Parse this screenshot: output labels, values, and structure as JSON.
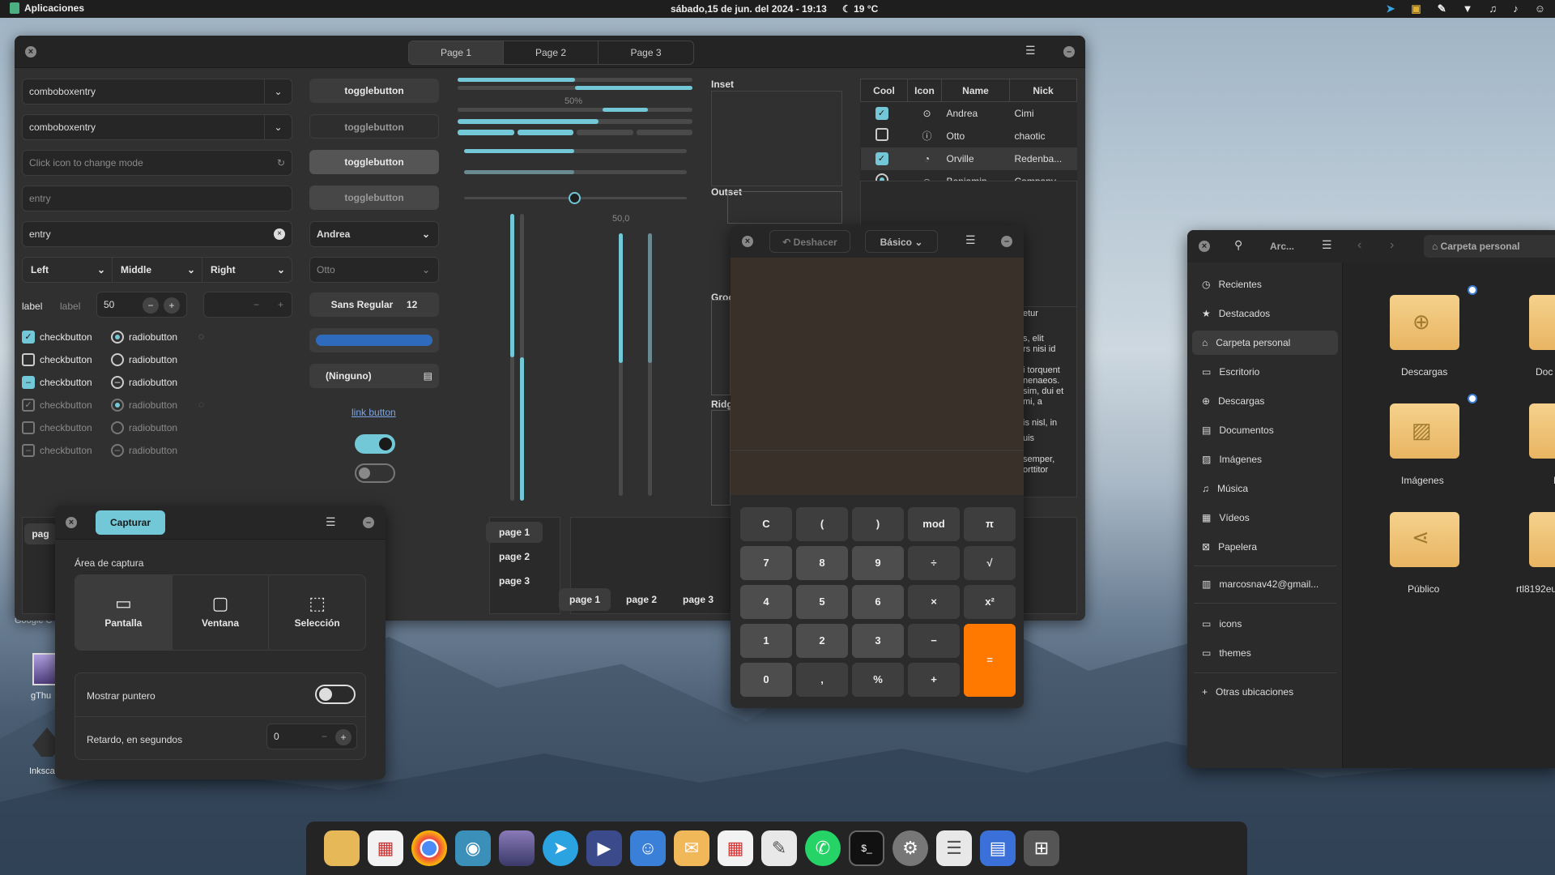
{
  "topbar": {
    "apps": "Aplicaciones",
    "clock": "sábado,15 de jun. del 2024 - 19:13",
    "weather": "19 °C"
  },
  "widget_factory": {
    "tabs": [
      "Page 1",
      "Page 2",
      "Page 3"
    ],
    "combo1": "comboboxentry",
    "combo2": "comboboxentry",
    "mode_entry": "Click icon to change mode",
    "entry1": "entry",
    "entry2": "entry",
    "seg": [
      "Left",
      "Middle",
      "Right"
    ],
    "spin": {
      "label1": "label",
      "label2": "label",
      "value": "50"
    },
    "checks": [
      "checkbutton",
      "checkbutton",
      "checkbutton",
      "checkbutton",
      "checkbutton",
      "checkbutton"
    ],
    "radios": [
      "radiobutton",
      "radiobutton",
      "radiobutton",
      "radiobutton",
      "radiobutton",
      "radiobutton"
    ],
    "toggles": [
      "togglebutton",
      "togglebutton",
      "togglebutton",
      "togglebutton"
    ],
    "combo_andrea": "Andrea",
    "combo_otto": "Otto",
    "font": "Sans Regular",
    "font_size": "12",
    "file": "(Ninguno)",
    "link": "link button",
    "progress_label": "50%",
    "scale_value": "50,0",
    "frames": [
      "Inset",
      "Outset",
      "Groo",
      "Ridg"
    ],
    "table": {
      "headers": [
        "Cool",
        "Icon",
        "Name",
        "Nick"
      ],
      "rows": [
        [
          "Andrea",
          "Cimi"
        ],
        [
          "Otto",
          "chaotic"
        ],
        [
          "Orville",
          "Redenba..."
        ],
        [
          "Benjamin",
          "Company"
        ]
      ]
    },
    "lorem": [
      "etur",
      "s, elit",
      "rs nisi id",
      "i torquent",
      "nenaeos.",
      "sim, dui et",
      "mi, a",
      "is nisl, in",
      "uis",
      "semper,",
      "orttitor"
    ],
    "pages": [
      "page 1",
      "page 2",
      "page 3"
    ],
    "pages_h": [
      "page 1",
      "page 2",
      "page 3"
    ],
    "pag_stub": "pag"
  },
  "calculator": {
    "undo": "Deshacer",
    "mode": "Básico",
    "keys": [
      "C",
      "(",
      ")",
      "mod",
      "π",
      "7",
      "8",
      "9",
      "÷",
      "√",
      "4",
      "5",
      "6",
      "×",
      "x²",
      "1",
      "2",
      "3",
      "−",
      "=",
      "0",
      ",",
      "%",
      "+"
    ]
  },
  "files": {
    "title": "Arc...",
    "path": "Carpeta personal",
    "sidebar": [
      "Recientes",
      "Destacados",
      "Carpeta personal",
      "Escritorio",
      "Descargas",
      "Documentos",
      "Imágenes",
      "Música",
      "Vídeos",
      "Papelera",
      "marcosnav42@gmail...",
      "icons",
      "themes",
      "Otras ubicaciones"
    ],
    "folders": [
      "Descargas",
      "Doc",
      "Imágenes",
      "M",
      "Público",
      "rtl8192eu"
    ]
  },
  "capture": {
    "title": "Capturar",
    "area": "Área de captura",
    "modes": [
      "Pantalla",
      "Ventana",
      "Selección"
    ],
    "pointer": "Mostrar puntero",
    "delay": "Retardo, en segundos",
    "delay_value": "0"
  },
  "desktop": {
    "icons": [
      "gThu",
      "Inksca",
      "Google C"
    ]
  },
  "colors": {
    "accent": "#73c8d8",
    "orange": "#ff7800"
  }
}
